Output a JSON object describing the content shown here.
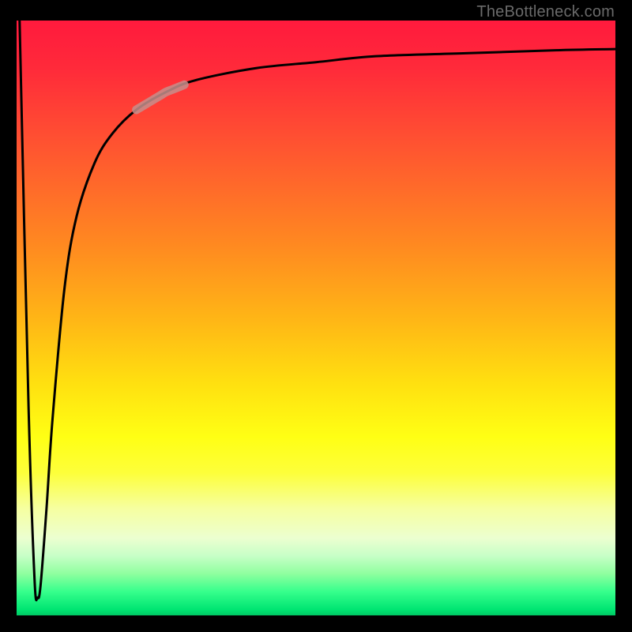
{
  "attribution": "TheBottleneck.com",
  "colors": {
    "frame": "#000000",
    "curve": "#000000",
    "highlight": "#c68f8c",
    "gradient_top": "#ff1a3d",
    "gradient_bottom": "#00c864"
  },
  "chart_data": {
    "type": "line",
    "title": "",
    "xlabel": "",
    "ylabel": "",
    "xlim": [
      0,
      100
    ],
    "ylim": [
      0,
      100
    ],
    "grid": false,
    "series": [
      {
        "name": "curve",
        "x": [
          0.5,
          2.0,
          3.0,
          3.5,
          4.0,
          5.0,
          6.0,
          8.0,
          10.0,
          13.0,
          16.0,
          20.0,
          25.0,
          30.0,
          40.0,
          50.0,
          60.0,
          75.0,
          90.0,
          100.0
        ],
        "y": [
          100,
          35,
          6,
          3,
          5,
          18,
          33,
          55,
          67,
          76,
          81,
          85,
          88,
          90,
          92,
          93,
          94,
          94.5,
          95,
          95.2
        ]
      }
    ],
    "highlight_segment": {
      "series": "curve",
      "x_start": 20.0,
      "x_end": 28.0
    }
  }
}
